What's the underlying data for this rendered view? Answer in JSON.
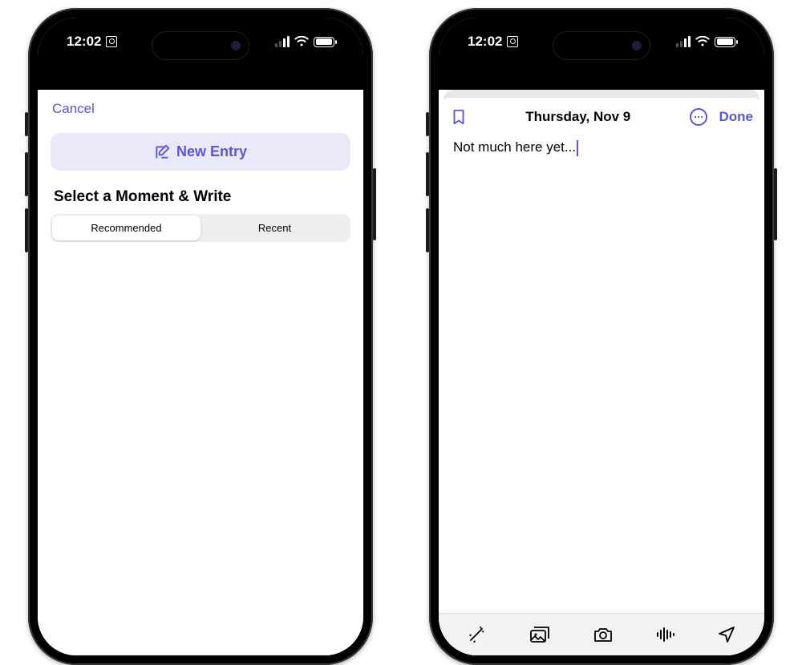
{
  "status": {
    "time": "12:02"
  },
  "colors": {
    "accent": "#5856d6"
  },
  "left": {
    "cancel": "Cancel",
    "new_entry_label": "New Entry",
    "section_title": "Select a Moment & Write",
    "tabs": {
      "recommended": "Recommended",
      "recent": "Recent"
    }
  },
  "right": {
    "date_title": "Thursday, Nov 9",
    "done": "Done",
    "body_text": "Not much here yet...",
    "toolbar_icons": [
      "magic-wand",
      "photo-library",
      "camera",
      "audio-waveform",
      "location"
    ]
  }
}
